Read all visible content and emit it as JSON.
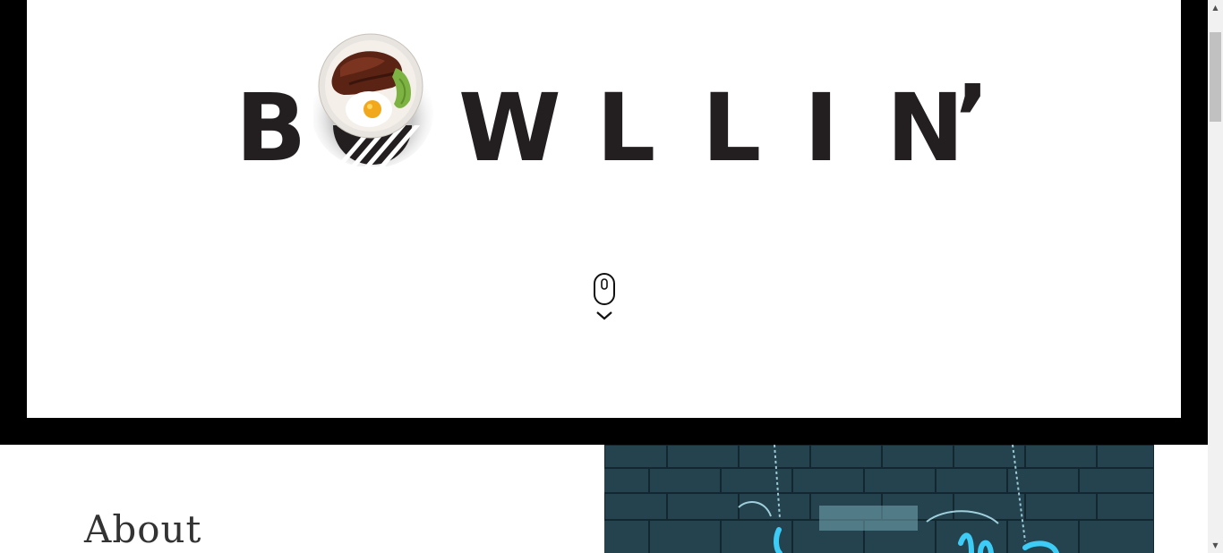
{
  "hero": {
    "logo_letters": [
      "B",
      "W",
      "L",
      "L",
      "I",
      "N",
      "’"
    ],
    "logo_bowl_icon": "rice-bowl-with-fried-egg-icon",
    "scroll_cue_icon": "mouse-scroll-down-icon"
  },
  "about": {
    "heading": "About"
  },
  "photo": {
    "icon": "neon-sign-photo"
  },
  "colors": {
    "frame": "#000000",
    "logo_text": "#231f20",
    "heading_text": "#333333",
    "photo_tint": "#1aa7c8"
  }
}
